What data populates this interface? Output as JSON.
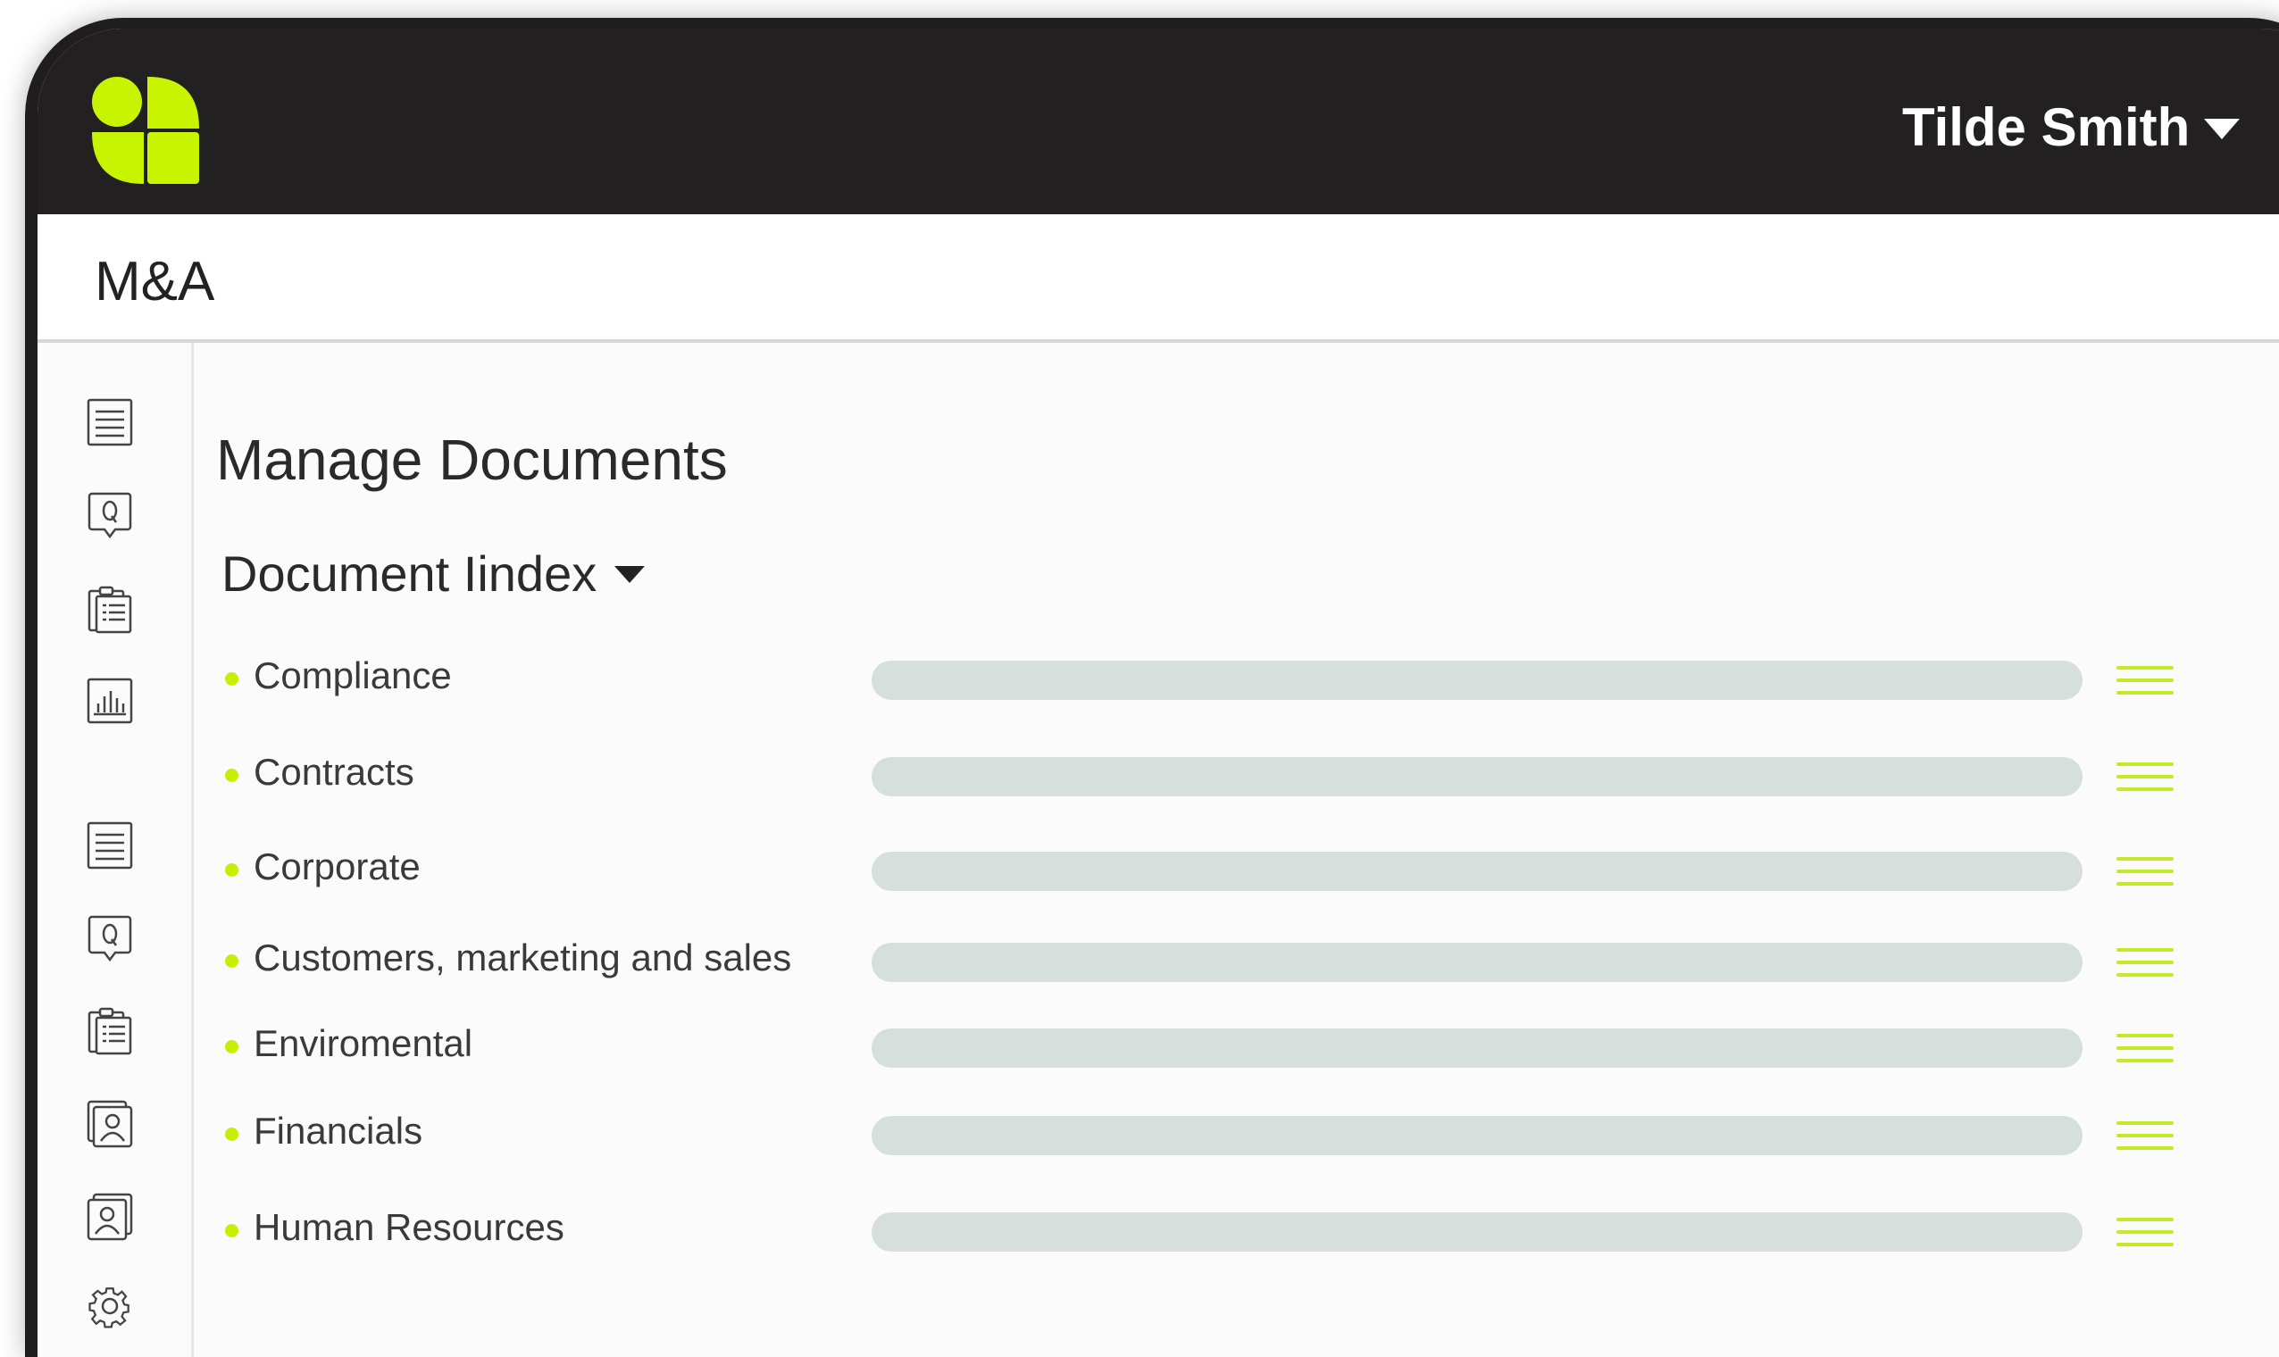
{
  "header": {
    "user_name": "Tilde Smith",
    "user_menu_icon": "caret-down-icon",
    "logo_icon": "four-leaf-logo",
    "accent_color": "#c8f400",
    "bar_color": "#232021"
  },
  "subheader": {
    "title": "M&A"
  },
  "sidebar": {
    "icons": [
      "document-list-icon",
      "qa-icon",
      "clipboard-icon",
      "bar-chart-icon",
      "document-list-icon",
      "qa-icon",
      "clipboard-icon",
      "user-card-icon",
      "user-stack-icon",
      "gear-icon"
    ]
  },
  "main": {
    "page_title": "Manage Documents",
    "index_selector": {
      "label": "Document Iindex",
      "icon": "caret-down-icon"
    },
    "documents": [
      {
        "label": "Compliance"
      },
      {
        "label": "Contracts"
      },
      {
        "label": "Corporate"
      },
      {
        "label": "Customers, marketing and sales"
      },
      {
        "label": "Enviromental"
      },
      {
        "label": "Financials"
      },
      {
        "label": "Human Resources"
      }
    ],
    "row_handle_icon": "drag-handle-icon",
    "bullet_color": "#c6f000",
    "bar_color": "#d7dfdd"
  }
}
